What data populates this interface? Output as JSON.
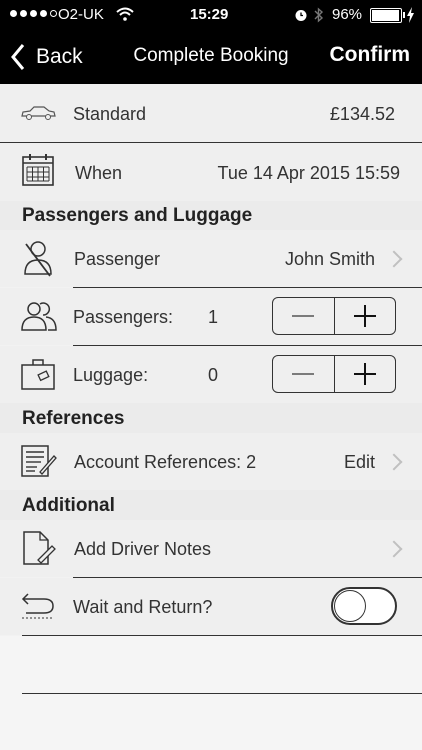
{
  "status_bar": {
    "carrier": "O2-UK",
    "time": "15:29",
    "battery": "96%"
  },
  "nav": {
    "back_label": "Back",
    "title": "Complete Booking",
    "confirm_label": "Confirm"
  },
  "vehicle": {
    "label": "Standard",
    "price": "£134.52",
    "icon": "car-icon"
  },
  "when": {
    "label": "When",
    "value": "Tue 14 Apr 2015 15:59",
    "icon": "calendar-icon"
  },
  "sections": {
    "passengers_luggage": "Passengers and Luggage",
    "references": "References",
    "additional": "Additional"
  },
  "passenger": {
    "label": "Passenger",
    "value": "John Smith",
    "icon": "person-icon"
  },
  "passengers_count": {
    "label": "Passengers:",
    "value": "1",
    "icon": "people-icon"
  },
  "luggage_count": {
    "label": "Luggage:",
    "value": "0",
    "icon": "suitcase-icon"
  },
  "account_refs": {
    "label": "Account References: 2",
    "action": "Edit",
    "icon": "document-icon"
  },
  "driver_notes": {
    "label": "Add Driver Notes",
    "icon": "note-edit-icon"
  },
  "wait_return": {
    "label": "Wait and Return?",
    "icon": "return-arrow-icon",
    "enabled": false
  }
}
